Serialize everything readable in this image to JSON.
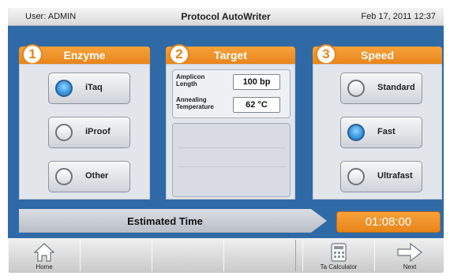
{
  "header": {
    "user": "User: ADMIN",
    "app_title": "Protocol AutoWriter",
    "datetime": "Feb 17, 2011 12:37"
  },
  "panels": {
    "enzyme": {
      "number": "1",
      "title": "Enzyme",
      "options": [
        {
          "label": "iTaq",
          "selected": true
        },
        {
          "label": "iProof",
          "selected": false
        },
        {
          "label": "Other",
          "selected": false
        }
      ]
    },
    "target": {
      "number": "2",
      "title": "Target",
      "amplicon_label": "Amplicon Length",
      "amplicon_value": "100 bp",
      "annealing_label": "Annealing Temperature",
      "annealing_value": "62 °C"
    },
    "speed": {
      "number": "3",
      "title": "Speed",
      "options": [
        {
          "label": "Standard",
          "selected": false
        },
        {
          "label": "Fast",
          "selected": true
        },
        {
          "label": "Ultrafast",
          "selected": false
        }
      ]
    }
  },
  "estimate": {
    "label": "Estimated Time",
    "value": "01:08:00"
  },
  "toolbar": {
    "home_label": "Home",
    "calculator_label": "Ta Calculator",
    "next_label": "Next"
  },
  "icons": {
    "home": "home-icon",
    "calculator": "calculator-icon",
    "next": "arrow-right-icon"
  },
  "colors": {
    "accent": "#e8851a",
    "screen_bg": "#2f6aa6",
    "selected": "#3b9be0"
  }
}
